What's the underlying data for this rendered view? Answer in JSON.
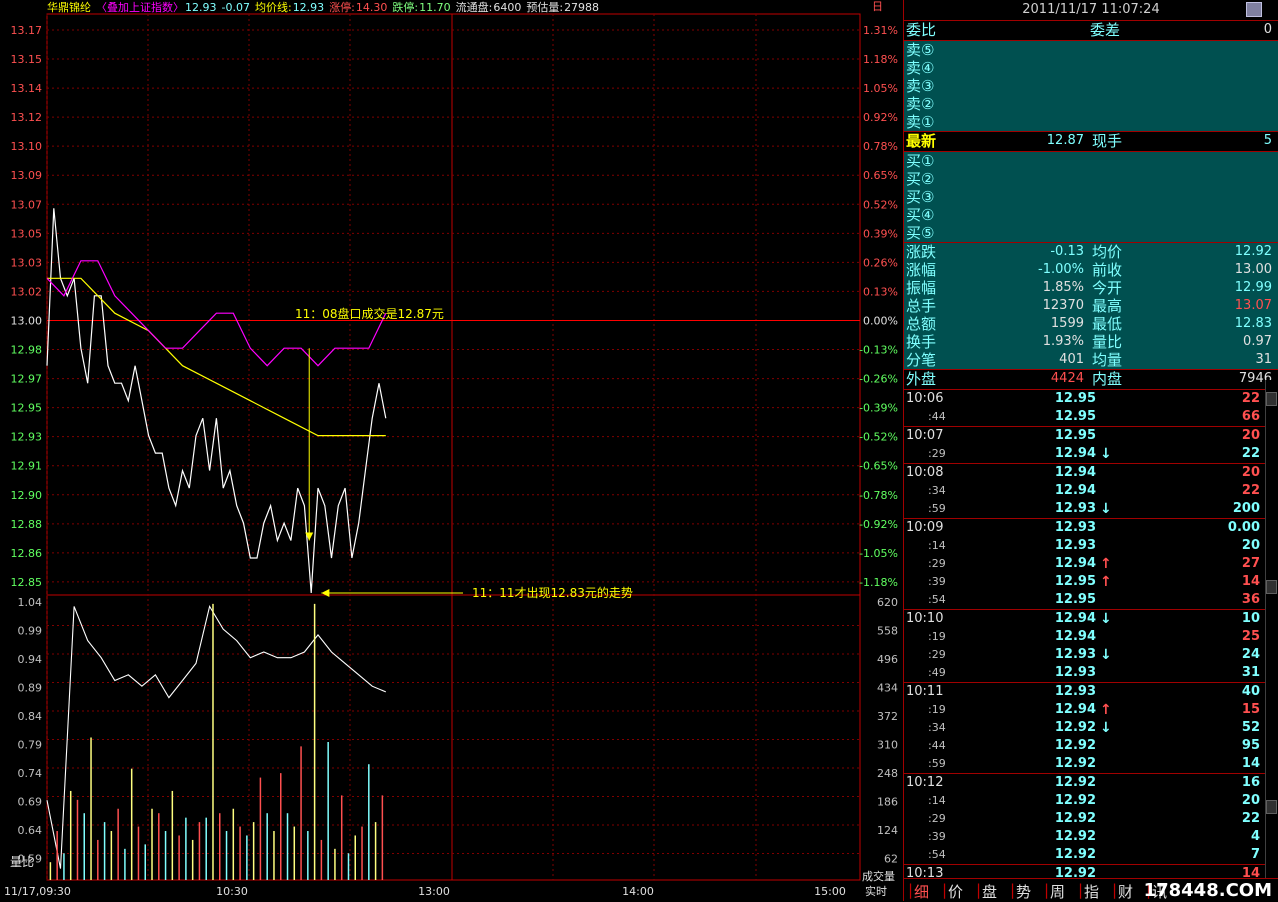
{
  "header": {
    "name": "华鼎锦纶",
    "overlay": "〈叠加上证指数〉",
    "price": "12.93",
    "change": "-0.07",
    "avg_label": "均价线:",
    "avg_value": "12.93",
    "limit_up_label": "涨停:",
    "limit_up": "14.30",
    "limit_down_label": "跌停:",
    "limit_down": "11.70",
    "float_label": "流通盘:",
    "float_value": "6400",
    "est_label": "预估量:",
    "est_value": "27988",
    "corner": "日"
  },
  "chart_data": {
    "type": "line",
    "price_axis_left": [
      "13.17",
      "13.15",
      "13.14",
      "13.12",
      "13.10",
      "13.09",
      "13.07",
      "13.05",
      "13.03",
      "13.02",
      "13.00",
      "12.98",
      "12.97",
      "12.95",
      "12.93",
      "12.91",
      "12.90",
      "12.88",
      "12.86",
      "12.85"
    ],
    "price_axis_right": [
      "1.31%",
      "1.18%",
      "1.05%",
      "0.92%",
      "0.78%",
      "0.65%",
      "0.52%",
      "0.39%",
      "0.26%",
      "0.13%",
      "0.00%",
      "-0.13%",
      "-0.26%",
      "-0.39%",
      "-0.52%",
      "-0.65%",
      "-0.78%",
      "-0.92%",
      "-1.05%",
      "-1.18%"
    ],
    "ylim": [
      12.84,
      13.17
    ],
    "prev_close": 13.0,
    "volume_axis_left": [
      "1.04",
      "0.99",
      "0.94",
      "0.89",
      "0.84",
      "0.79",
      "0.74",
      "0.69",
      "0.64",
      "0.59"
    ],
    "volume_axis_right": [
      "620",
      "558",
      "496",
      "434",
      "372",
      "310",
      "248",
      "186",
      "124",
      "62"
    ],
    "volume_left_label": "量比",
    "volume_right_label": "成交量",
    "time_labels": [
      "11/17,09:30",
      "10:30",
      "13:00",
      "14:00",
      "15:00"
    ],
    "time_right_label": "实时",
    "x_minutes_total": 240,
    "series": [
      {
        "name": "price",
        "color": "#ffffff",
        "x": [
          0,
          2,
          4,
          6,
          8,
          10,
          12,
          14,
          16,
          18,
          20,
          22,
          24,
          26,
          28,
          30,
          32,
          34,
          36,
          38,
          40,
          42,
          44,
          46,
          48,
          50,
          52,
          54,
          56,
          58,
          60,
          62,
          64,
          66,
          68,
          70,
          72,
          74,
          76,
          78,
          80,
          82,
          84,
          86,
          88,
          90,
          92,
          94,
          96,
          98,
          100
        ],
        "values": [
          12.97,
          13.06,
          13.02,
          13.01,
          13.02,
          12.98,
          12.96,
          13.01,
          13.01,
          12.97,
          12.96,
          12.96,
          12.95,
          12.97,
          12.95,
          12.93,
          12.92,
          12.92,
          12.9,
          12.89,
          12.91,
          12.9,
          12.93,
          12.94,
          12.91,
          12.94,
          12.9,
          12.91,
          12.89,
          12.88,
          12.86,
          12.86,
          12.88,
          12.89,
          12.87,
          12.88,
          12.87,
          12.9,
          12.89,
          12.84,
          12.9,
          12.89,
          12.86,
          12.89,
          12.9,
          12.86,
          12.88,
          12.91,
          12.94,
          12.96,
          12.94
        ]
      },
      {
        "name": "avg",
        "color": "#ffff00",
        "x": [
          0,
          10,
          20,
          30,
          40,
          50,
          60,
          70,
          80,
          90,
          100
        ],
        "values": [
          13.02,
          13.02,
          13.0,
          12.99,
          12.97,
          12.96,
          12.95,
          12.94,
          12.93,
          12.93,
          12.93
        ]
      },
      {
        "name": "index",
        "color": "#ff00ff",
        "x": [
          0,
          5,
          10,
          15,
          20,
          25,
          30,
          35,
          40,
          45,
          50,
          55,
          60,
          65,
          70,
          75,
          80,
          85,
          90,
          95,
          100
        ],
        "values": [
          13.02,
          13.01,
          13.03,
          13.03,
          13.01,
          13.0,
          12.99,
          12.98,
          12.98,
          12.99,
          13.0,
          13.0,
          12.98,
          12.97,
          12.98,
          12.98,
          12.97,
          12.98,
          12.98,
          12.98,
          13.0
        ]
      }
    ],
    "volume_ratio": {
      "x": [
        0,
        4,
        8,
        12,
        16,
        20,
        24,
        28,
        32,
        36,
        40,
        44,
        48,
        52,
        56,
        60,
        64,
        68,
        72,
        76,
        80,
        84,
        88,
        92,
        96,
        100
      ],
      "values": [
        0.7,
        0.58,
        1.04,
        0.98,
        0.95,
        0.91,
        0.92,
        0.9,
        0.92,
        0.88,
        0.91,
        0.94,
        1.04,
        1.0,
        0.98,
        0.95,
        0.96,
        0.95,
        0.95,
        0.96,
        0.99,
        0.96,
        0.94,
        0.92,
        0.9,
        0.89
      ]
    },
    "volumes": {
      "x": [
        1,
        3,
        5,
        7,
        9,
        11,
        13,
        15,
        17,
        19,
        21,
        23,
        25,
        27,
        29,
        31,
        33,
        35,
        37,
        39,
        41,
        43,
        45,
        47,
        49,
        51,
        53,
        55,
        57,
        59,
        61,
        63,
        65,
        67,
        69,
        71,
        73,
        75,
        77,
        79,
        81,
        83,
        85,
        87,
        89,
        91,
        93,
        95,
        97,
        99
      ],
      "values": [
        40,
        110,
        60,
        200,
        180,
        150,
        320,
        90,
        130,
        110,
        160,
        70,
        250,
        120,
        80,
        160,
        150,
        110,
        200,
        100,
        140,
        90,
        130,
        140,
        620,
        150,
        110,
        160,
        120,
        100,
        130,
        230,
        150,
        110,
        240,
        150,
        120,
        300,
        110,
        620,
        90,
        310,
        70,
        190,
        60,
        100,
        120,
        260,
        130,
        190
      ]
    },
    "annotations": [
      {
        "text": "11：08盘口成交是12.87元"
      },
      {
        "text": "11：11才出现12.83元的走势"
      }
    ]
  },
  "panel": {
    "datetime": "2011/11/17 11:07:24",
    "ratio_label": "委比",
    "diff_label": "委差",
    "diff_value": "0",
    "sells": [
      "卖⑤",
      "卖④",
      "卖③",
      "卖②",
      "卖①"
    ],
    "latest_label": "最新",
    "latest_value": "12.87",
    "hand_label": "现手",
    "hand_value": "5",
    "buys": [
      "买①",
      "买②",
      "买③",
      "买④",
      "买⑤"
    ],
    "stats": [
      {
        "l1": "涨跌",
        "v1": "-0.13",
        "c1": "#80ffff",
        "l2": "均价",
        "v2": "12.92",
        "c2": "#80ffff"
      },
      {
        "l1": "涨幅",
        "v1": "-1.00%",
        "c1": "#80ffff",
        "l2": "前收",
        "v2": "13.00",
        "c2": "#e0e0e0"
      },
      {
        "l1": "振幅",
        "v1": "1.85%",
        "c1": "#e0e0e0",
        "l2": "今开",
        "v2": "12.99",
        "c2": "#80ffff"
      },
      {
        "l1": "总手",
        "v1": "12370",
        "c1": "#e0e0e0",
        "l2": "最高",
        "v2": "13.07",
        "c2": "#ff5050"
      },
      {
        "l1": "总额",
        "v1": "1599",
        "c1": "#e0e0e0",
        "l2": "最低",
        "v2": "12.83",
        "c2": "#80ffff"
      },
      {
        "l1": "换手",
        "v1": "1.93%",
        "c1": "#e0e0e0",
        "l2": "量比",
        "v2": "0.97",
        "c2": "#e0e0e0"
      },
      {
        "l1": "分笔",
        "v1": "401",
        "c1": "#e0e0e0",
        "l2": "均量",
        "v2": "31",
        "c2": "#e0e0e0"
      }
    ],
    "outer_label": "外盘",
    "outer_value": "4424",
    "inner_label": "内盘",
    "inner_value": "7946",
    "ticks": [
      {
        "t": "10:06",
        "sub": false,
        "p": "12.95",
        "a": "",
        "q": "22",
        "qc": "#ff5050",
        "sep": false
      },
      {
        "t": ":44",
        "sub": true,
        "p": "12.95",
        "a": "",
        "q": "66",
        "qc": "#ff5050",
        "sep": false
      },
      {
        "t": "10:07",
        "sub": false,
        "p": "12.95",
        "a": "",
        "q": "20",
        "qc": "#ff5050",
        "sep": true
      },
      {
        "t": ":29",
        "sub": true,
        "p": "12.94",
        "a": "down",
        "q": "22",
        "qc": "#80ffff",
        "sep": false
      },
      {
        "t": "10:08",
        "sub": false,
        "p": "12.94",
        "a": "",
        "q": "20",
        "qc": "#ff5050",
        "sep": true
      },
      {
        "t": ":34",
        "sub": true,
        "p": "12.94",
        "a": "",
        "q": "22",
        "qc": "#ff5050",
        "sep": false
      },
      {
        "t": ":59",
        "sub": true,
        "p": "12.93",
        "a": "down",
        "q": "200",
        "qc": "#80ffff",
        "sep": false
      },
      {
        "t": "10:09",
        "sub": false,
        "p": "12.93",
        "a": "",
        "q": "0.00",
        "qc": "#80ffff",
        "sep": true
      },
      {
        "t": ":14",
        "sub": true,
        "p": "12.93",
        "a": "",
        "q": "20",
        "qc": "#80ffff",
        "sep": false
      },
      {
        "t": ":29",
        "sub": true,
        "p": "12.94",
        "a": "up",
        "q": "27",
        "qc": "#ff5050",
        "sep": false
      },
      {
        "t": ":39",
        "sub": true,
        "p": "12.95",
        "a": "up",
        "q": "14",
        "qc": "#ff5050",
        "sep": false
      },
      {
        "t": ":54",
        "sub": true,
        "p": "12.95",
        "a": "",
        "q": "36",
        "qc": "#ff5050",
        "sep": false
      },
      {
        "t": "10:10",
        "sub": false,
        "p": "12.94",
        "a": "down",
        "q": "10",
        "qc": "#80ffff",
        "sep": true
      },
      {
        "t": ":19",
        "sub": true,
        "p": "12.94",
        "a": "",
        "q": "25",
        "qc": "#ff5050",
        "sep": false
      },
      {
        "t": ":29",
        "sub": true,
        "p": "12.93",
        "a": "down",
        "q": "24",
        "qc": "#80ffff",
        "sep": false
      },
      {
        "t": ":49",
        "sub": true,
        "p": "12.93",
        "a": "",
        "q": "31",
        "qc": "#80ffff",
        "sep": false
      },
      {
        "t": "10:11",
        "sub": false,
        "p": "12.93",
        "a": "",
        "q": "40",
        "qc": "#80ffff",
        "sep": true
      },
      {
        "t": ":19",
        "sub": true,
        "p": "12.94",
        "a": "up",
        "q": "15",
        "qc": "#ff5050",
        "sep": false
      },
      {
        "t": ":34",
        "sub": true,
        "p": "12.92",
        "a": "down",
        "q": "52",
        "qc": "#80ffff",
        "sep": false
      },
      {
        "t": ":44",
        "sub": true,
        "p": "12.92",
        "a": "",
        "q": "95",
        "qc": "#80ffff",
        "sep": false
      },
      {
        "t": ":59",
        "sub": true,
        "p": "12.92",
        "a": "",
        "q": "14",
        "qc": "#80ffff",
        "sep": false
      },
      {
        "t": "10:12",
        "sub": false,
        "p": "12.92",
        "a": "",
        "q": "16",
        "qc": "#80ffff",
        "sep": true
      },
      {
        "t": ":14",
        "sub": true,
        "p": "12.92",
        "a": "",
        "q": "20",
        "qc": "#80ffff",
        "sep": false
      },
      {
        "t": ":29",
        "sub": true,
        "p": "12.92",
        "a": "",
        "q": "22",
        "qc": "#80ffff",
        "sep": false
      },
      {
        "t": ":39",
        "sub": true,
        "p": "12.92",
        "a": "",
        "q": "4",
        "qc": "#80ffff",
        "sep": false
      },
      {
        "t": ":54",
        "sub": true,
        "p": "12.92",
        "a": "",
        "q": "7",
        "qc": "#80ffff",
        "sep": false
      },
      {
        "t": "10:13",
        "sub": false,
        "p": "12.92",
        "a": "",
        "q": "14",
        "qc": "#ff5050",
        "sep": true
      }
    ],
    "tabs": [
      "细",
      "价",
      "盘",
      "势",
      "周",
      "指",
      "财",
      "讯"
    ],
    "watermark": "178448.COM"
  }
}
